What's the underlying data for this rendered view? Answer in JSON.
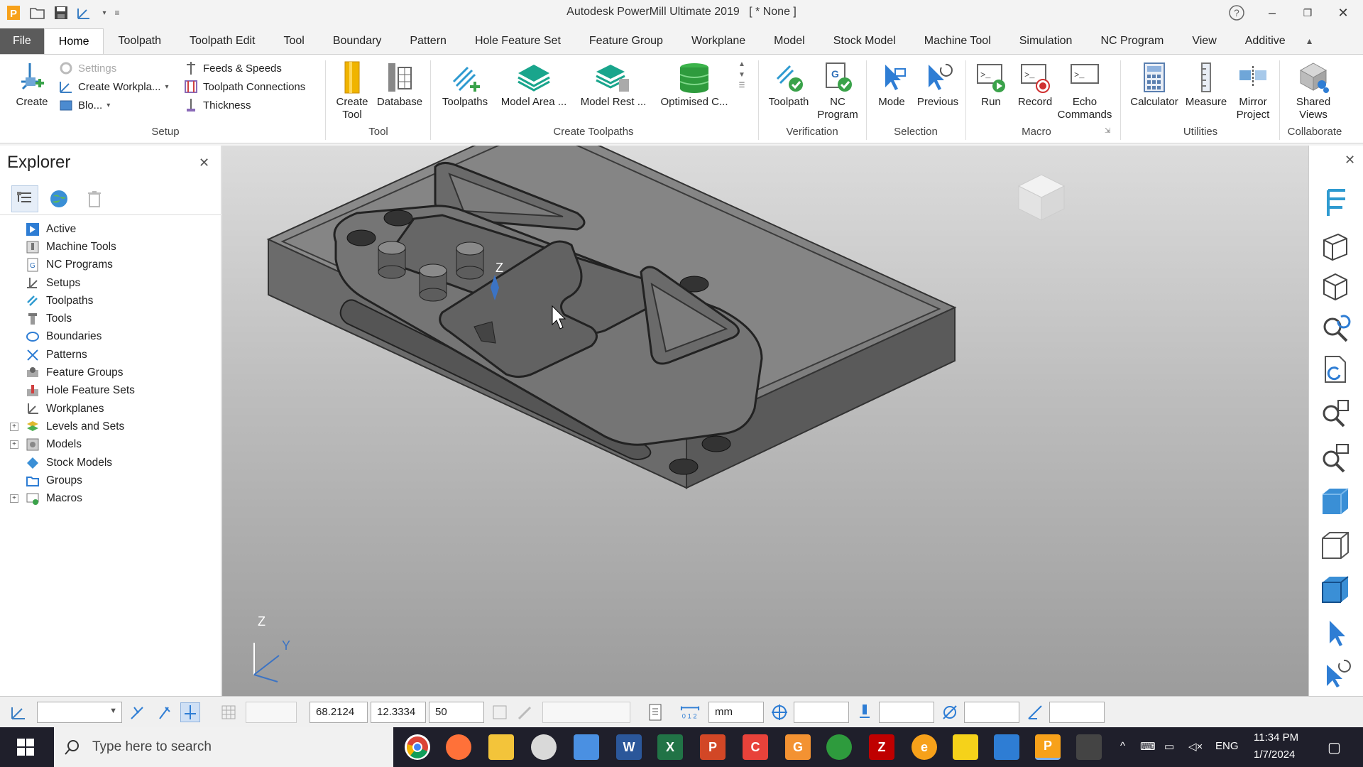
{
  "app": {
    "title": "Autodesk PowerMill Ultimate 2019",
    "project": "[ * None ]",
    "help_icon": "help-circle-icon"
  },
  "menu_tabs": [
    "File",
    "Home",
    "Toolpath",
    "Toolpath Edit",
    "Tool",
    "Boundary",
    "Pattern",
    "Hole Feature Set",
    "Feature Group",
    "Workplane",
    "Model",
    "Stock Model",
    "Machine Tool",
    "Simulation",
    "NC Program",
    "View",
    "Additive"
  ],
  "active_tab": "Home",
  "ribbon": {
    "setup": {
      "group_label": "Setup",
      "create": "Create",
      "settings": "Settings",
      "create_workplane": "Create Workpla...",
      "block": "Blo...",
      "feeds_speeds": "Feeds & Speeds",
      "toolpath_connections": "Toolpath Connections",
      "thickness": "Thickness"
    },
    "tool": {
      "group_label": "Tool",
      "create_tool": "Create Tool",
      "database": "Database"
    },
    "create_toolpaths": {
      "group_label": "Create Toolpaths",
      "toolpaths": "Toolpaths",
      "model_area": "Model Area ...",
      "model_rest": "Model Rest ...",
      "optimised": "Optimised C..."
    },
    "verification": {
      "group_label": "Verification",
      "toolpath": "Toolpath",
      "nc_program": "NC Program"
    },
    "selection": {
      "group_label": "Selection",
      "mode": "Mode",
      "previous": "Previous"
    },
    "macro": {
      "group_label": "Macro",
      "run": "Run",
      "record": "Record",
      "echo_commands": "Echo Commands"
    },
    "utilities": {
      "group_label": "Utilities",
      "calculator": "Calculator",
      "measure": "Measure",
      "mirror_project": "Mirror Project"
    },
    "collaborate": {
      "group_label": "Collaborate",
      "shared_views": "Shared Views"
    }
  },
  "explorer": {
    "title": "Explorer",
    "tabs": [
      "tree-view-icon",
      "globe-icon",
      "trash-icon"
    ],
    "items": [
      {
        "label": "Active",
        "icon": "active-icon",
        "expandable": false
      },
      {
        "label": "Machine Tools",
        "icon": "machine-tools-icon",
        "expandable": false
      },
      {
        "label": "NC Programs",
        "icon": "nc-programs-icon",
        "expandable": false
      },
      {
        "label": "Setups",
        "icon": "setups-icon",
        "expandable": false
      },
      {
        "label": "Toolpaths",
        "icon": "toolpaths-icon",
        "expandable": false
      },
      {
        "label": "Tools",
        "icon": "tools-icon",
        "expandable": false
      },
      {
        "label": "Boundaries",
        "icon": "boundaries-icon",
        "expandable": false
      },
      {
        "label": "Patterns",
        "icon": "patterns-icon",
        "expandable": false
      },
      {
        "label": "Feature Groups",
        "icon": "feature-groups-icon",
        "expandable": false
      },
      {
        "label": "Hole Feature Sets",
        "icon": "hole-feature-sets-icon",
        "expandable": false
      },
      {
        "label": "Workplanes",
        "icon": "workplanes-icon",
        "expandable": false
      },
      {
        "label": "Levels and Sets",
        "icon": "levels-icon",
        "expandable": true
      },
      {
        "label": "Models",
        "icon": "models-icon",
        "expandable": true
      },
      {
        "label": "Stock Models",
        "icon": "stock-models-icon",
        "expandable": false
      },
      {
        "label": "Groups",
        "icon": "groups-icon",
        "expandable": false
      },
      {
        "label": "Macros",
        "icon": "macros-icon",
        "expandable": true
      }
    ]
  },
  "viewport": {
    "workplane_axis_label": "Z",
    "triad_labels": {
      "z": "Z",
      "y": "Y"
    },
    "view_cube": "view-cube"
  },
  "statusbar": {
    "x": "68.2124",
    "y": "12.3334",
    "z": "50",
    "units": "mm"
  },
  "taskbar": {
    "search_placeholder": "Type here to search",
    "lang": "ENG",
    "time": "11:34 PM",
    "date": "1/7/2024"
  }
}
